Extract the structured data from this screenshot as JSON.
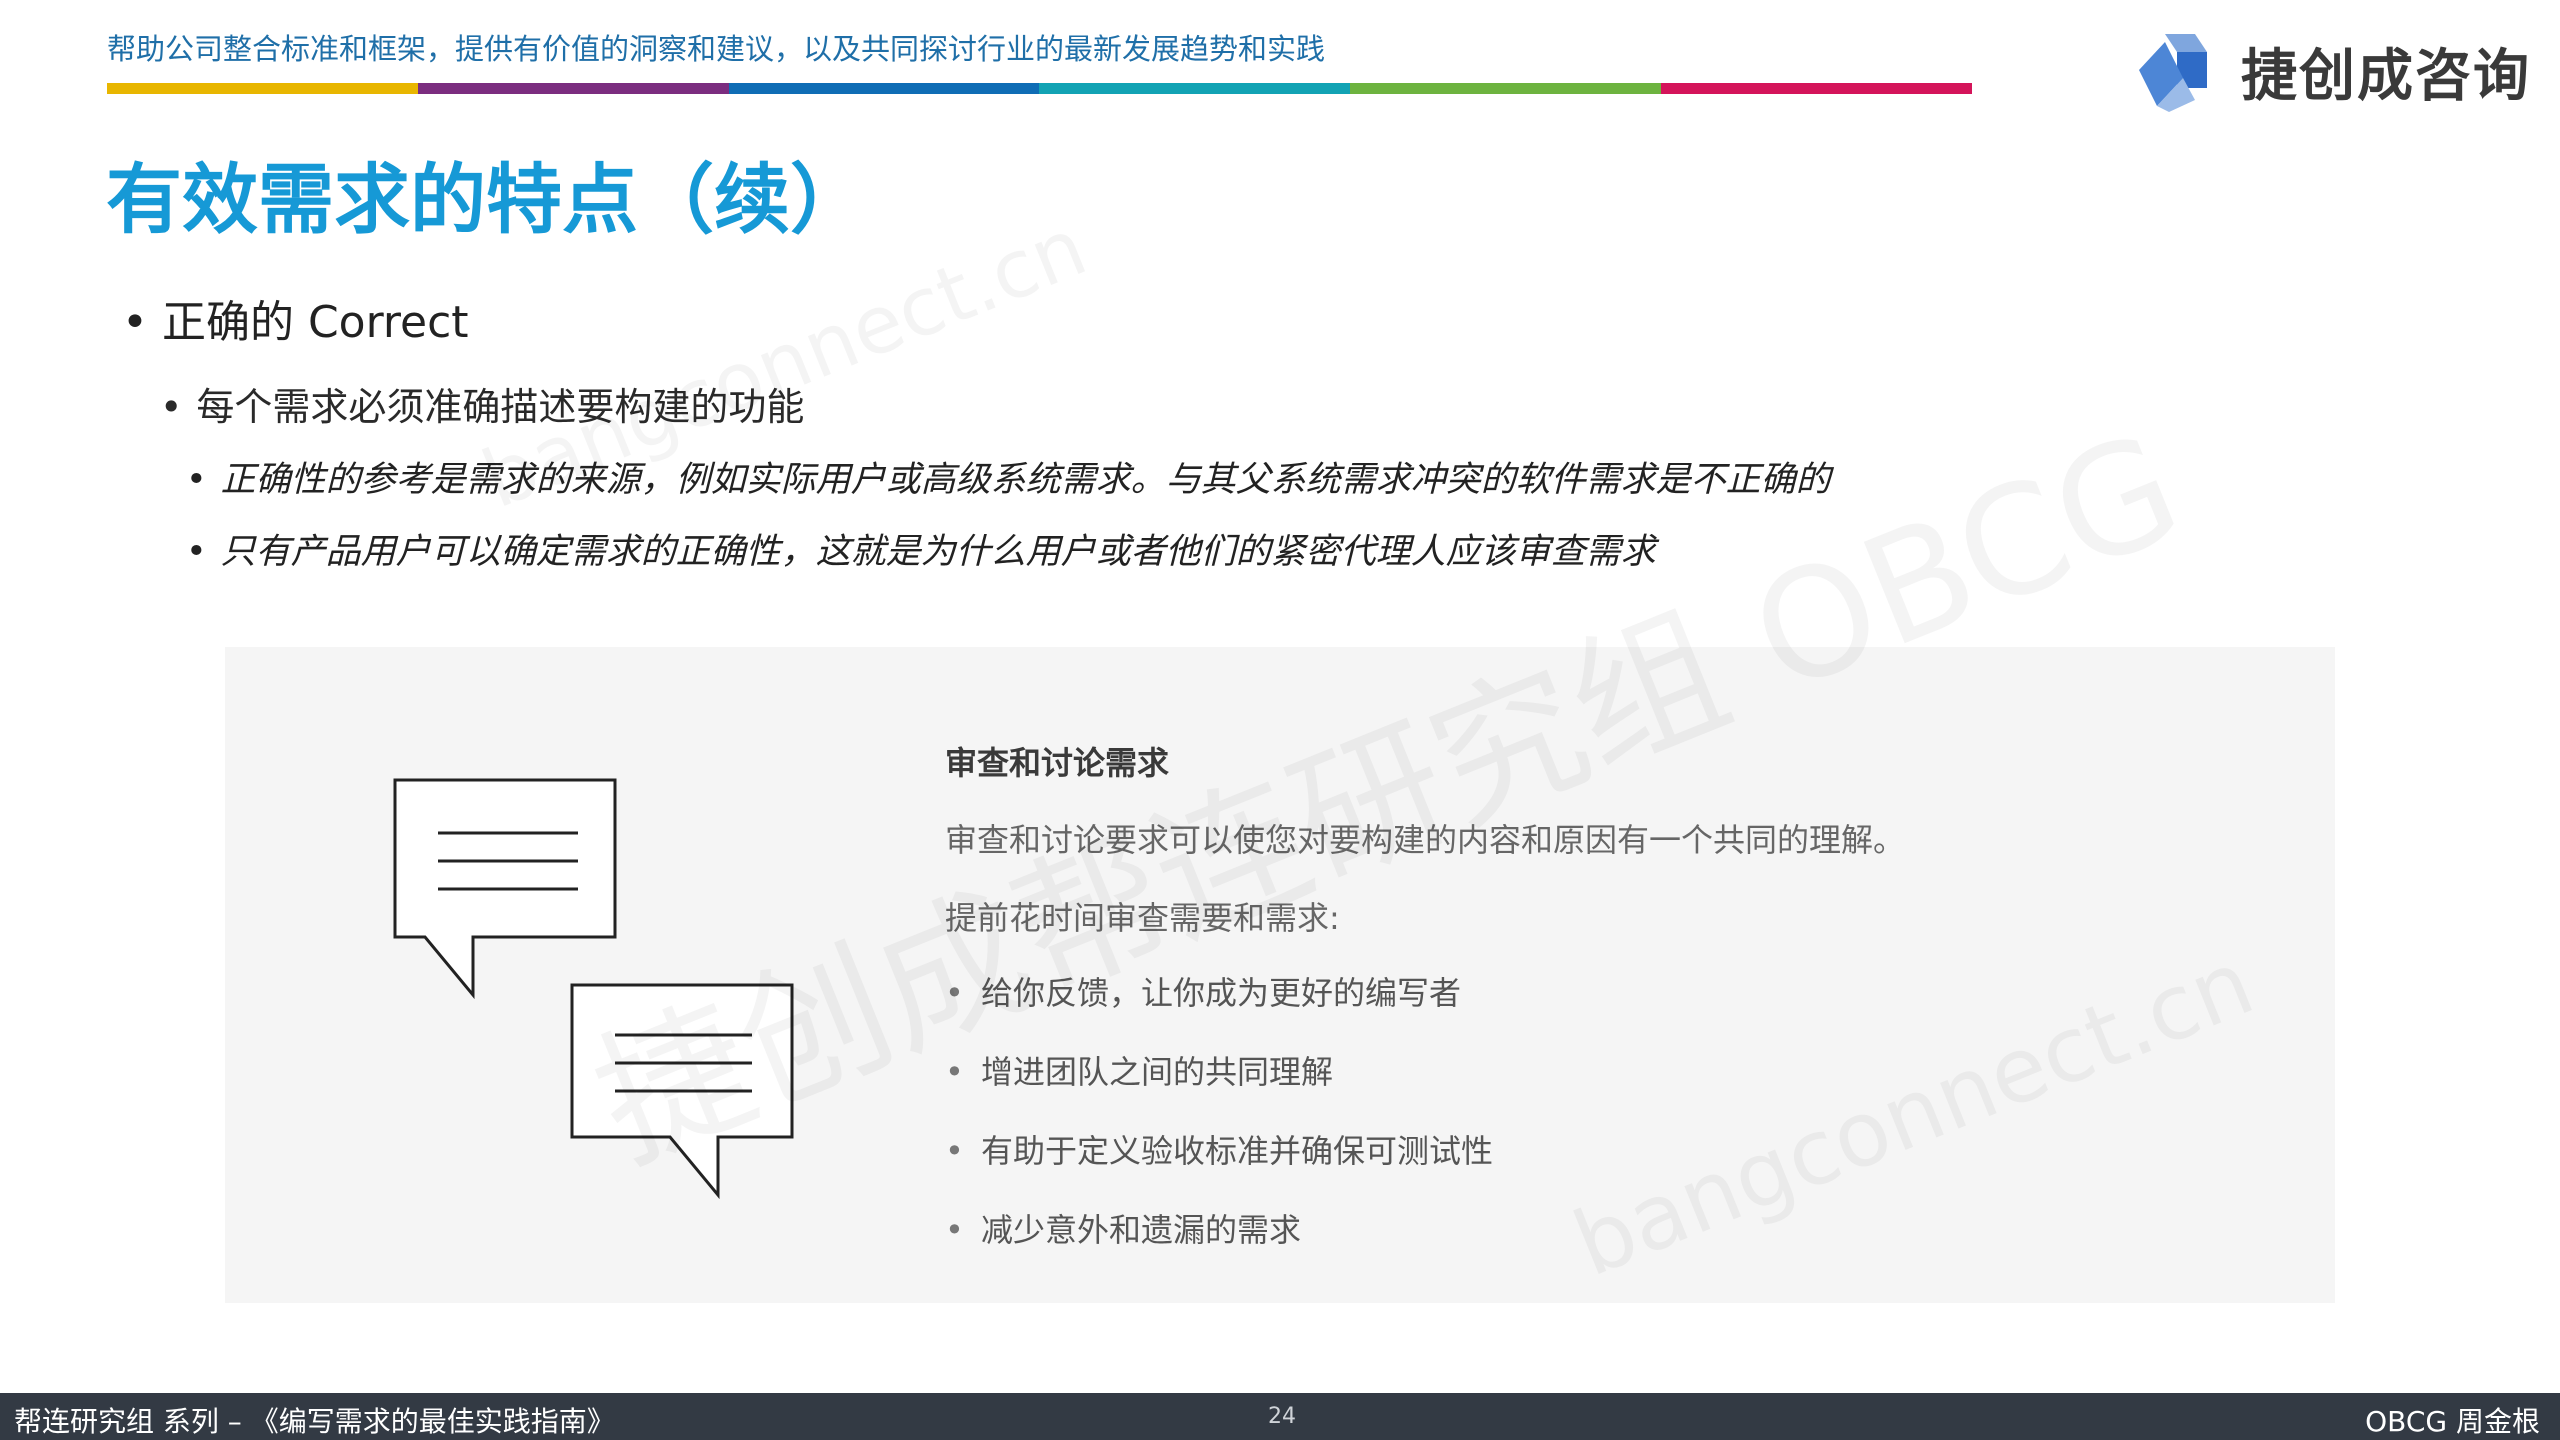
{
  "header": {
    "tagline": "帮助公司整合标准和框架，提供有价值的洞察和建议，以及共同探讨行业的最新发展趋势和实践",
    "colorbar": [
      "#e8b600",
      "#7b2d7f",
      "#0f6db5",
      "#12a3b4",
      "#6db33f",
      "#d4145a"
    ],
    "logo_text": "捷创成咨询",
    "logo_icon": "cube-logo-icon"
  },
  "title": "有效需求的特点（续）",
  "bullets": {
    "level1": "正确的 Correct",
    "level2": "每个需求必须准确描述要构建的功能",
    "level3": [
      "正确性的参考是需求的来源，例如实际用户或高级系统需求。与其父系统需求冲突的软件需求是不正确的",
      "只有产品用户可以确定需求的正确性，这就是为什么用户或者他们的紧密代理人应该审查需求"
    ]
  },
  "panel": {
    "icon": "chat-bubbles-icon",
    "heading": "审查和讨论需求",
    "text1": "审查和讨论要求可以使您对要构建的内容和原因有一个共同的理解。",
    "text2": "提前花时间审查需要和需求:",
    "list": [
      "给你反馈，让你成为更好的编写者",
      "增进团队之间的共同理解",
      "有助于定义验收标准并确保可测试性",
      "减少意外和遗漏的需求"
    ]
  },
  "watermarks": [
    "bangconnect.cn",
    "捷创成帮连研究组 OBCG",
    "bangconnect.cn"
  ],
  "footer": {
    "left": "帮连研究组 系列 – 《编写需求的最佳实践指南》",
    "page": "24",
    "right": "OBCG 周金根"
  }
}
